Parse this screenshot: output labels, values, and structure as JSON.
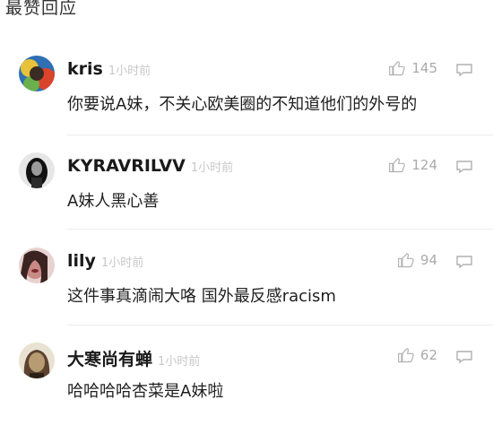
{
  "section": {
    "title": "最赞回应"
  },
  "comments": [
    {
      "username": "kris",
      "time": "1小时前",
      "text": "你要说A妹，不关心欧美圈的不知道他们的外号的",
      "likes": "145",
      "avatar_colors": [
        "#2f6fb3",
        "#e8c23a",
        "#d9442b",
        "#6ab04c"
      ]
    },
    {
      "username": "KYRAVRILVV",
      "time": "1小时前",
      "text": "A妹人黑心善",
      "likes": "124",
      "avatar_colors": [
        "#111111",
        "#4a4a4a",
        "#9a9a9a",
        "#2a2a2a"
      ]
    },
    {
      "username": "lily",
      "time": "1小时前",
      "text": "这件事真滴闹大咯 国外最反感racism",
      "likes": "94",
      "avatar_colors": [
        "#e7d2d0",
        "#7a2a2a",
        "#c88a84",
        "#3a2320"
      ]
    },
    {
      "username": "大寒尚有蝉",
      "time": "1小时前",
      "text": "哈哈哈哈杏菜是A妹啦",
      "likes": "62",
      "avatar_colors": [
        "#e9e2d2",
        "#5b4330",
        "#b79b73",
        "#2b2119"
      ]
    }
  ]
}
